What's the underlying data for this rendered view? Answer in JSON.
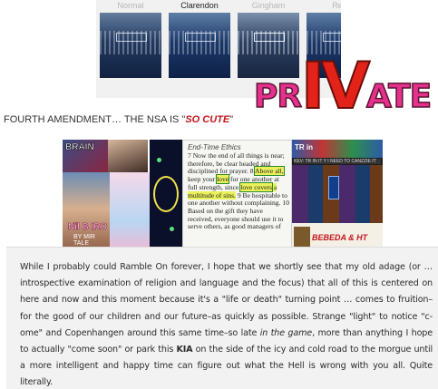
{
  "filters": {
    "items": [
      {
        "label": "Normal",
        "selected": false
      },
      {
        "label": "Clarendon",
        "selected": true
      },
      {
        "label": "Gingham",
        "selected": false
      },
      {
        "label": "Re",
        "selected": false
      }
    ]
  },
  "stamp": {
    "prefix": "PR",
    "roman": "IV",
    "suffix": "ATE",
    "colors": {
      "pink": "#e5308e",
      "red": "#e3231a"
    }
  },
  "headline": {
    "text": "FOURTH AMENDMENT… THE NSA IS \"",
    "emphasis": "SO CUTE",
    "close": "\"",
    "emphasis_color": "#c2151b"
  },
  "collage": {
    "brain_tile": "BRAIN",
    "girl_tile_title": "Nil B IRO",
    "girl_tile_caption": "BY MIR TALE",
    "doc": {
      "title": "End-Time Ethics",
      "verse_1": "7 Now the end of all things is near; therefore, be clear headed and disciplined for prayer.",
      "verse_8_pre": "8 ",
      "verse_8_hl_1": "Above all,",
      "verse_8_mid_1": " keep your ",
      "verse_8_hl_love": "love",
      "verse_8_mid_2": " for one another at full strength, since ",
      "verse_8_hl_2": "love covers",
      "verse_8_mid_3": " a multitude of sins.",
      "verse_9": " 9 Be hospitable to one another without complaining.",
      "verse_10": " 10 Based on the gift they have received, everyone should use it to serve others, as good managers of"
    },
    "rt_tile": {
      "header": "TR  in",
      "caption": "KEV: TR IN IT Y I NEED TO CANZZIE IT",
      "banner": "BEBEDA & HT"
    }
  },
  "article": {
    "p1": "While I probably could Ramble On forever, I hope that we shortly see that my old adage (or … introspective examination of religion and language and the focus) that all of this is centered on here and now and this moment because it's a \"life or death\" turning point … comes to fruition–for the good of our children and our future–as quickly as possible. Strange \"light\" to notice \"c-ome\" and Copenhangen around this same time–so late ",
    "p1_em": "in the game",
    "p2": ", more than anything I hope to actually \"come soon\" or park this ",
    "p2_b": "KIA",
    "p3": " on the side of the icy and cold road to the morgue until a more intelligent and happy time can figure out what the Hell is wrong with you all. Quite literally."
  }
}
